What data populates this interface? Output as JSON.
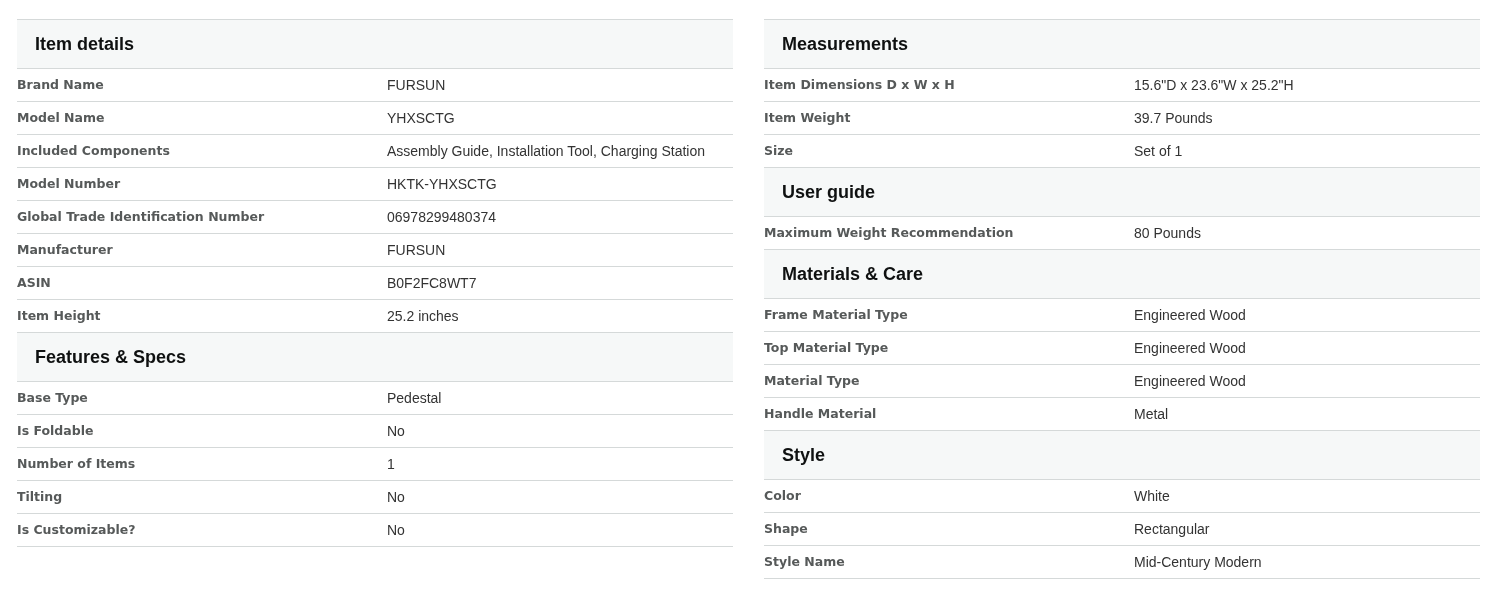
{
  "columns": [
    {
      "sections": [
        {
          "title": "Item details",
          "rows": [
            {
              "label": "Brand Name",
              "value": "FURSUN"
            },
            {
              "label": "Model Name",
              "value": "YHXSCTG"
            },
            {
              "label": "Included Components",
              "value": "Assembly Guide, Installation Tool, Charging Station"
            },
            {
              "label": "Model Number",
              "value": "HKTK-YHXSCTG"
            },
            {
              "label": "Global Trade Identification Number",
              "value": "06978299480374"
            },
            {
              "label": "Manufacturer",
              "value": "FURSUN"
            },
            {
              "label": "ASIN",
              "value": "B0F2FC8WT7"
            },
            {
              "label": "Item Height",
              "value": "25.2 inches"
            }
          ]
        },
        {
          "title": "Features & Specs",
          "rows": [
            {
              "label": "Base Type",
              "value": "Pedestal"
            },
            {
              "label": "Is Foldable",
              "value": "No"
            },
            {
              "label": "Number of Items",
              "value": "1"
            },
            {
              "label": "Tilting",
              "value": "No"
            },
            {
              "label": "Is Customizable?",
              "value": "No"
            }
          ]
        }
      ]
    },
    {
      "sections": [
        {
          "title": "Measurements",
          "rows": [
            {
              "label": "Item Dimensions D x W x H",
              "value": "15.6\"D x 23.6\"W x 25.2\"H"
            },
            {
              "label": "Item Weight",
              "value": "39.7 Pounds"
            },
            {
              "label": "Size",
              "value": "Set of 1"
            }
          ]
        },
        {
          "title": "User guide",
          "rows": [
            {
              "label": "Maximum Weight Recommendation",
              "value": "80 Pounds"
            }
          ]
        },
        {
          "title": "Materials & Care",
          "rows": [
            {
              "label": "Frame Material Type",
              "value": "Engineered Wood"
            },
            {
              "label": "Top Material Type",
              "value": "Engineered Wood"
            },
            {
              "label": "Material Type",
              "value": "Engineered Wood"
            },
            {
              "label": "Handle Material",
              "value": "Metal"
            }
          ]
        },
        {
          "title": "Style",
          "rows": [
            {
              "label": "Color",
              "value": "White"
            },
            {
              "label": "Shape",
              "value": "Rectangular"
            },
            {
              "label": "Style Name",
              "value": "Mid-Century Modern"
            }
          ]
        }
      ]
    }
  ]
}
